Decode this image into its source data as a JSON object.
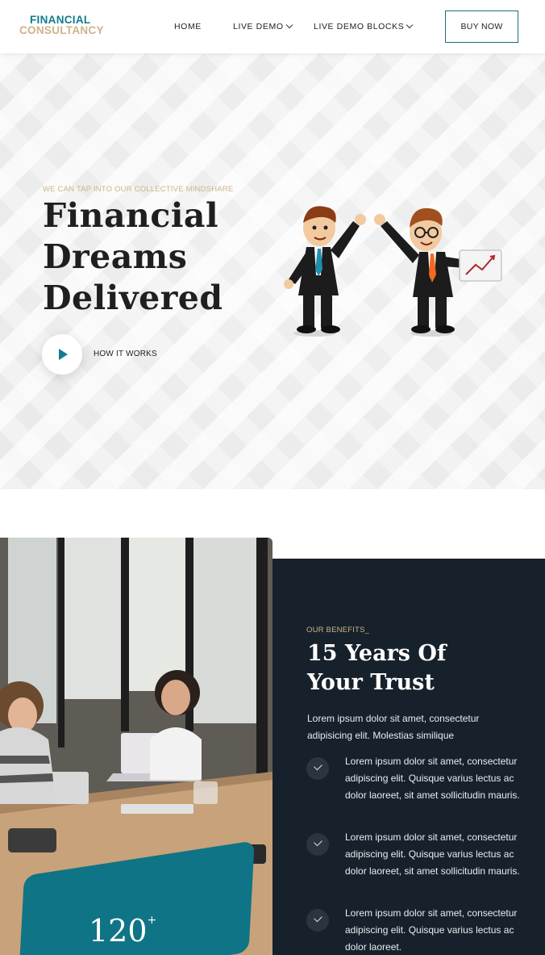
{
  "header": {
    "logo_line1": "FINANCIAL",
    "logo_line2": "CONSULTANCY",
    "nav": [
      {
        "label": "HOME",
        "dropdown": false
      },
      {
        "label": "LIVE DEMO",
        "dropdown": true
      },
      {
        "label": "LIVE DEMO BLOCKS",
        "dropdown": true
      }
    ],
    "buy_label": "BUY NOW"
  },
  "hero": {
    "kicker": "WE CAN TAP INTO OUR COLLECTIVE MINDSHARE",
    "title_line1": "Financial",
    "title_line2": "Dreams",
    "title_line3": "Delivered",
    "cta_label": "HOW IT WORKS"
  },
  "benefits": {
    "kicker": "OUR BENEFITS_",
    "title_line1": "15 Years Of",
    "title_line2": "Your Trust",
    "intro": "Lorem ipsum dolor sit amet, consectetur adipisicing elit. Molestias similique",
    "items": [
      "Lorem ipsum dolor sit amet, consectetur adipiscing elit. Quisque varius lectus ac dolor laoreet, sit amet sollicitudin mauris.",
      "Lorem ipsum dolor sit amet, consectetur adipiscing elit. Quisque varius lectus ac dolor laoreet, sit amet sollicitudin mauris.",
      "Lorem ipsum dolor sit amet, consectetur adipiscing elit. Quisque varius lectus ac dolor laoreet."
    ],
    "counter_value": "120",
    "counter_suffix": "+"
  },
  "colors": {
    "brand_teal": "#0e7e8c",
    "brand_gold": "#cdb48a",
    "panel_dark": "#17212b",
    "counter_card": "#0f7485"
  },
  "icons": [
    "play-icon",
    "chevron-down-icon",
    "check-icon"
  ]
}
